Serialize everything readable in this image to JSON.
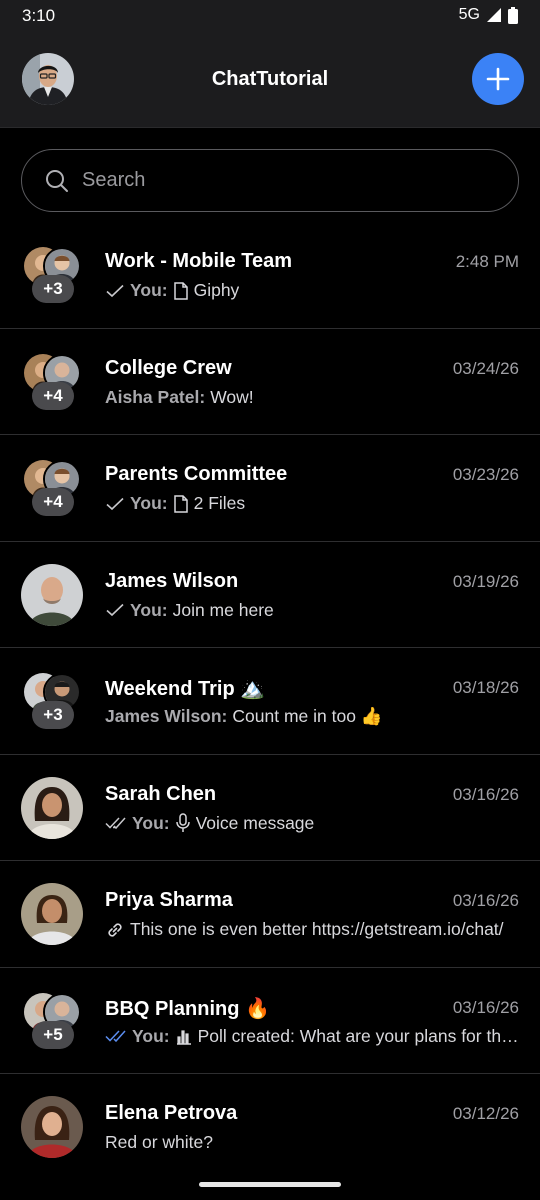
{
  "status": {
    "time": "3:10",
    "network": "5G"
  },
  "header": {
    "title": "ChatTutorial"
  },
  "search": {
    "placeholder": "Search"
  },
  "channels": [
    {
      "title": "Work - Mobile Team",
      "time": "2:48 PM",
      "badge": "+3",
      "sender": "You:",
      "message": "Giphy",
      "read": "single",
      "icon": "file-icon"
    },
    {
      "title": "College Crew",
      "time": "03/24/26",
      "badge": "+4",
      "sender": "Aisha Patel:",
      "message": "Wow!"
    },
    {
      "title": "Parents Committee",
      "time": "03/23/26",
      "badge": "+4",
      "sender": "You:",
      "message": "2 Files",
      "read": "single",
      "icon": "file-icon"
    },
    {
      "title": "James Wilson",
      "time": "03/19/26",
      "sender": "You:",
      "message": "Join me here",
      "read": "single"
    },
    {
      "title": "Weekend Trip 🏔️",
      "time": "03/18/26",
      "badge": "+3",
      "sender": "James Wilson:",
      "message": "Count me in too 👍"
    },
    {
      "title": "Sarah Chen",
      "time": "03/16/26",
      "sender": "You:",
      "message": "Voice message",
      "read": "double",
      "icon": "microphone-icon"
    },
    {
      "title": "Priya Sharma",
      "time": "03/16/26",
      "message": "This one is even better https://getstream.io/chat/",
      "icon": "link-icon"
    },
    {
      "title": "BBQ Planning 🔥",
      "time": "03/16/26",
      "badge": "+5",
      "sender": "You:",
      "message": "Poll created: What are your plans for the weekend?",
      "read": "double-blue",
      "icon": "poll-icon"
    },
    {
      "title": "Elena Petrova",
      "time": "03/12/26",
      "message": "Red or white?"
    }
  ],
  "colors": {
    "accent": "#3b82f6",
    "background": "#000000",
    "header": "#1c1c1e",
    "read_receipt": "#5b8def"
  }
}
